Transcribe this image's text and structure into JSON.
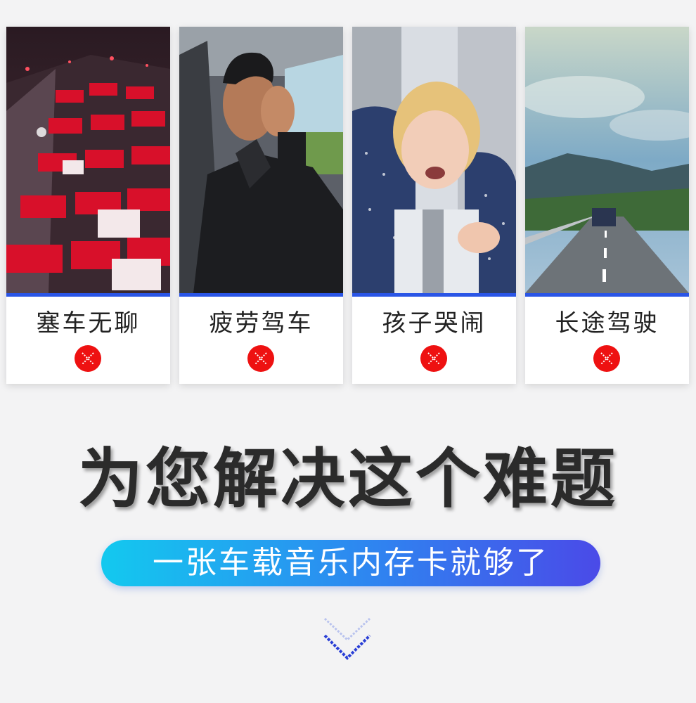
{
  "cards": [
    {
      "label": "塞车无聊",
      "photo_icon": "traffic-jam-photo",
      "status_icon": "red-x-icon"
    },
    {
      "label": "疲劳驾车",
      "photo_icon": "yawning-driver-photo",
      "status_icon": "red-x-icon"
    },
    {
      "label": "孩子哭闹",
      "photo_icon": "crying-child-photo",
      "status_icon": "red-x-icon"
    },
    {
      "label": "长途驾驶",
      "photo_icon": "highway-photo",
      "status_icon": "red-x-icon"
    }
  ],
  "headline": "为您解决这个难题",
  "subline": "一张车载音乐内存卡就够了",
  "colors": {
    "background": "#f3f3f4",
    "card_accent": "#2a55e6",
    "x_badge": "#ee1111",
    "pill_start": "#13c9ef",
    "pill_end": "#4a4ae8"
  },
  "scroll_indicator": "double-chevron-down-icon"
}
